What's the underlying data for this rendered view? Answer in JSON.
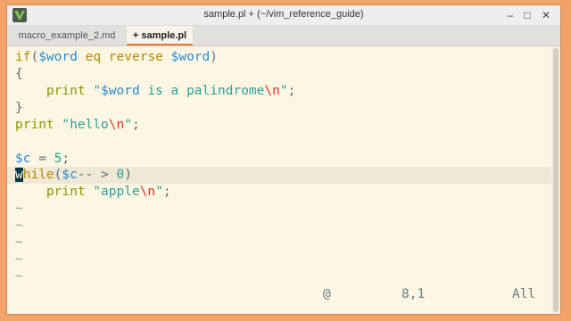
{
  "window": {
    "title": "sample.pl + (~/vim_reference_guide)",
    "minimize_glyph": "‒",
    "maximize_glyph": "□",
    "close_glyph": "✕"
  },
  "tabs": [
    {
      "label": "macro_example_2.md",
      "active": false
    },
    {
      "label": "+ sample.pl",
      "active": true
    }
  ],
  "code": {
    "l1": {
      "kw": "if",
      "p1": "(",
      "v1": "$word",
      "sp1": " ",
      "op": "eq",
      "sp2": " ",
      "fn": "reverse",
      "sp3": " ",
      "v2": "$word",
      "p2": ")"
    },
    "l2": "{",
    "l3": {
      "indent": "    ",
      "kw": "print",
      "sp": " ",
      "s1": "\"",
      "v": "$word",
      "s2": " is a palindrome",
      "esc": "\\n",
      "s3": "\"",
      "end": ";"
    },
    "l4": "}",
    "l5": {
      "kw": "print",
      "sp": " ",
      "s1": "\"hello",
      "esc": "\\n",
      "s2": "\"",
      "end": ";"
    },
    "l7": {
      "v": "$c",
      "op": " = ",
      "num": "5",
      "end": ";"
    },
    "l8": {
      "cur": "w",
      "kw": "hile",
      "p1": "(",
      "v": "$c",
      "op": "-- > ",
      "num": "0",
      "p2": ")"
    },
    "l9": {
      "indent": "    ",
      "kw": "print",
      "sp": " ",
      "s1": "\"apple",
      "esc": "\\n",
      "s2": "\"",
      "end": ";"
    },
    "tilde": "~"
  },
  "status": {
    "register": "@",
    "position": "8,1",
    "scroll": "All"
  },
  "colors": {
    "background": "#fdf6e3",
    "keyword": "#b58900",
    "variable": "#268bd2",
    "operator": "#859900",
    "string": "#2aa198",
    "escape": "#dc322f",
    "accent": "#e67a3a"
  }
}
